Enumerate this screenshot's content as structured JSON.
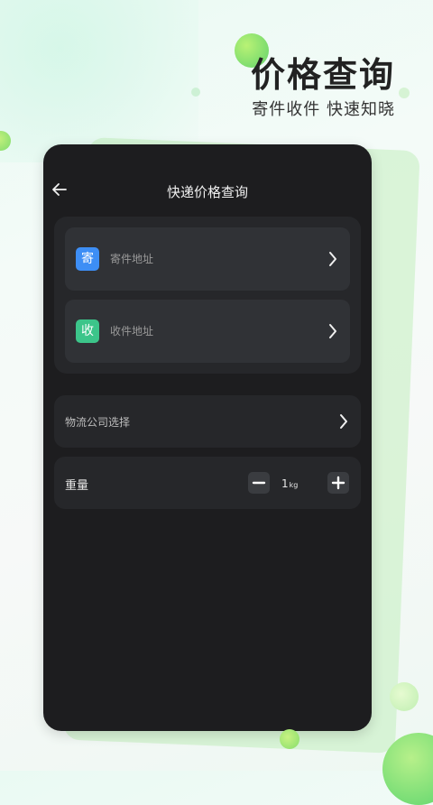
{
  "promo": {
    "headline": "价格查询",
    "subheadline": "寄件收件 快速知晓"
  },
  "screen": {
    "title": "快递价格查询",
    "sender": {
      "badge": "寄",
      "label": "寄件地址",
      "badge_color": "#3d8ef5"
    },
    "receiver": {
      "badge": "收",
      "label": "收件地址",
      "badge_color": "#3cc58a"
    },
    "company_label": "物流公司选择",
    "weight": {
      "label": "重量",
      "value": "1",
      "unit": "kg"
    },
    "icons": {
      "back": "arrow-left-icon",
      "chevron": "chevron-right-icon",
      "minus": "minus-icon",
      "plus": "plus-icon"
    }
  }
}
